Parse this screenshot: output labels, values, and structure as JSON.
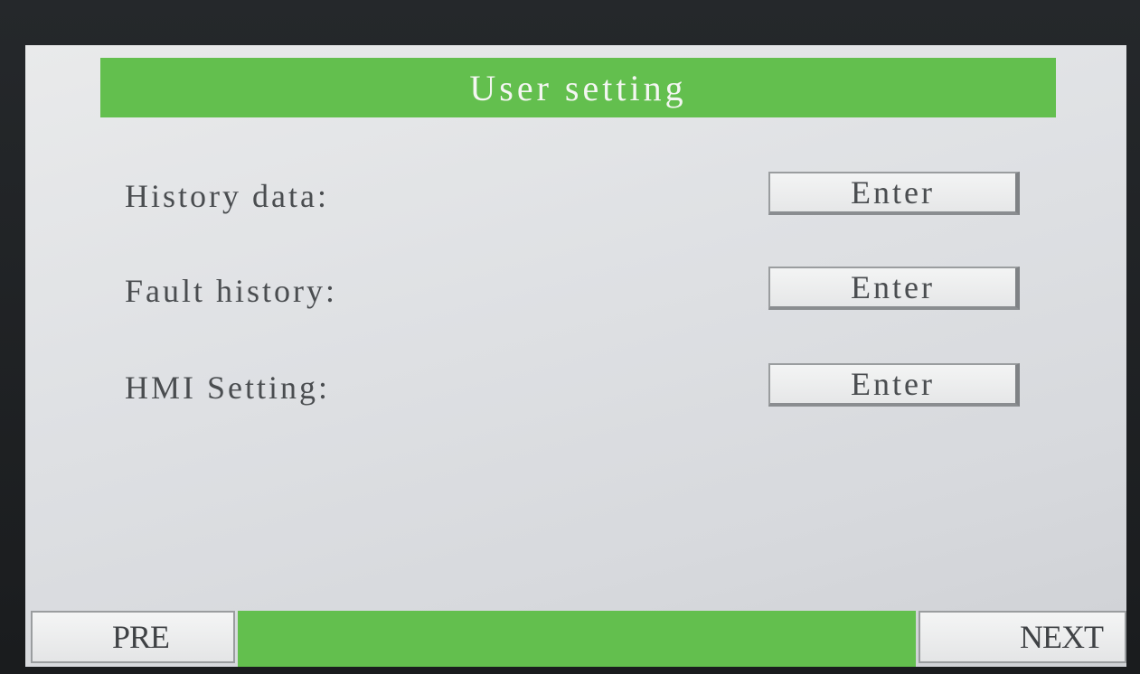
{
  "header": {
    "title": "User setting"
  },
  "rows": [
    {
      "label": "History data:",
      "button_label": "Enter"
    },
    {
      "label": "Fault history:",
      "button_label": "Enter"
    },
    {
      "label": "HMI Setting:",
      "button_label": "Enter"
    }
  ],
  "footer": {
    "prev_label": "PRE",
    "next_label": "NEXT"
  },
  "colors": {
    "accent_green": "#63bf4e",
    "screen_background": "#dfe1e4",
    "text": "#4a4d50"
  }
}
